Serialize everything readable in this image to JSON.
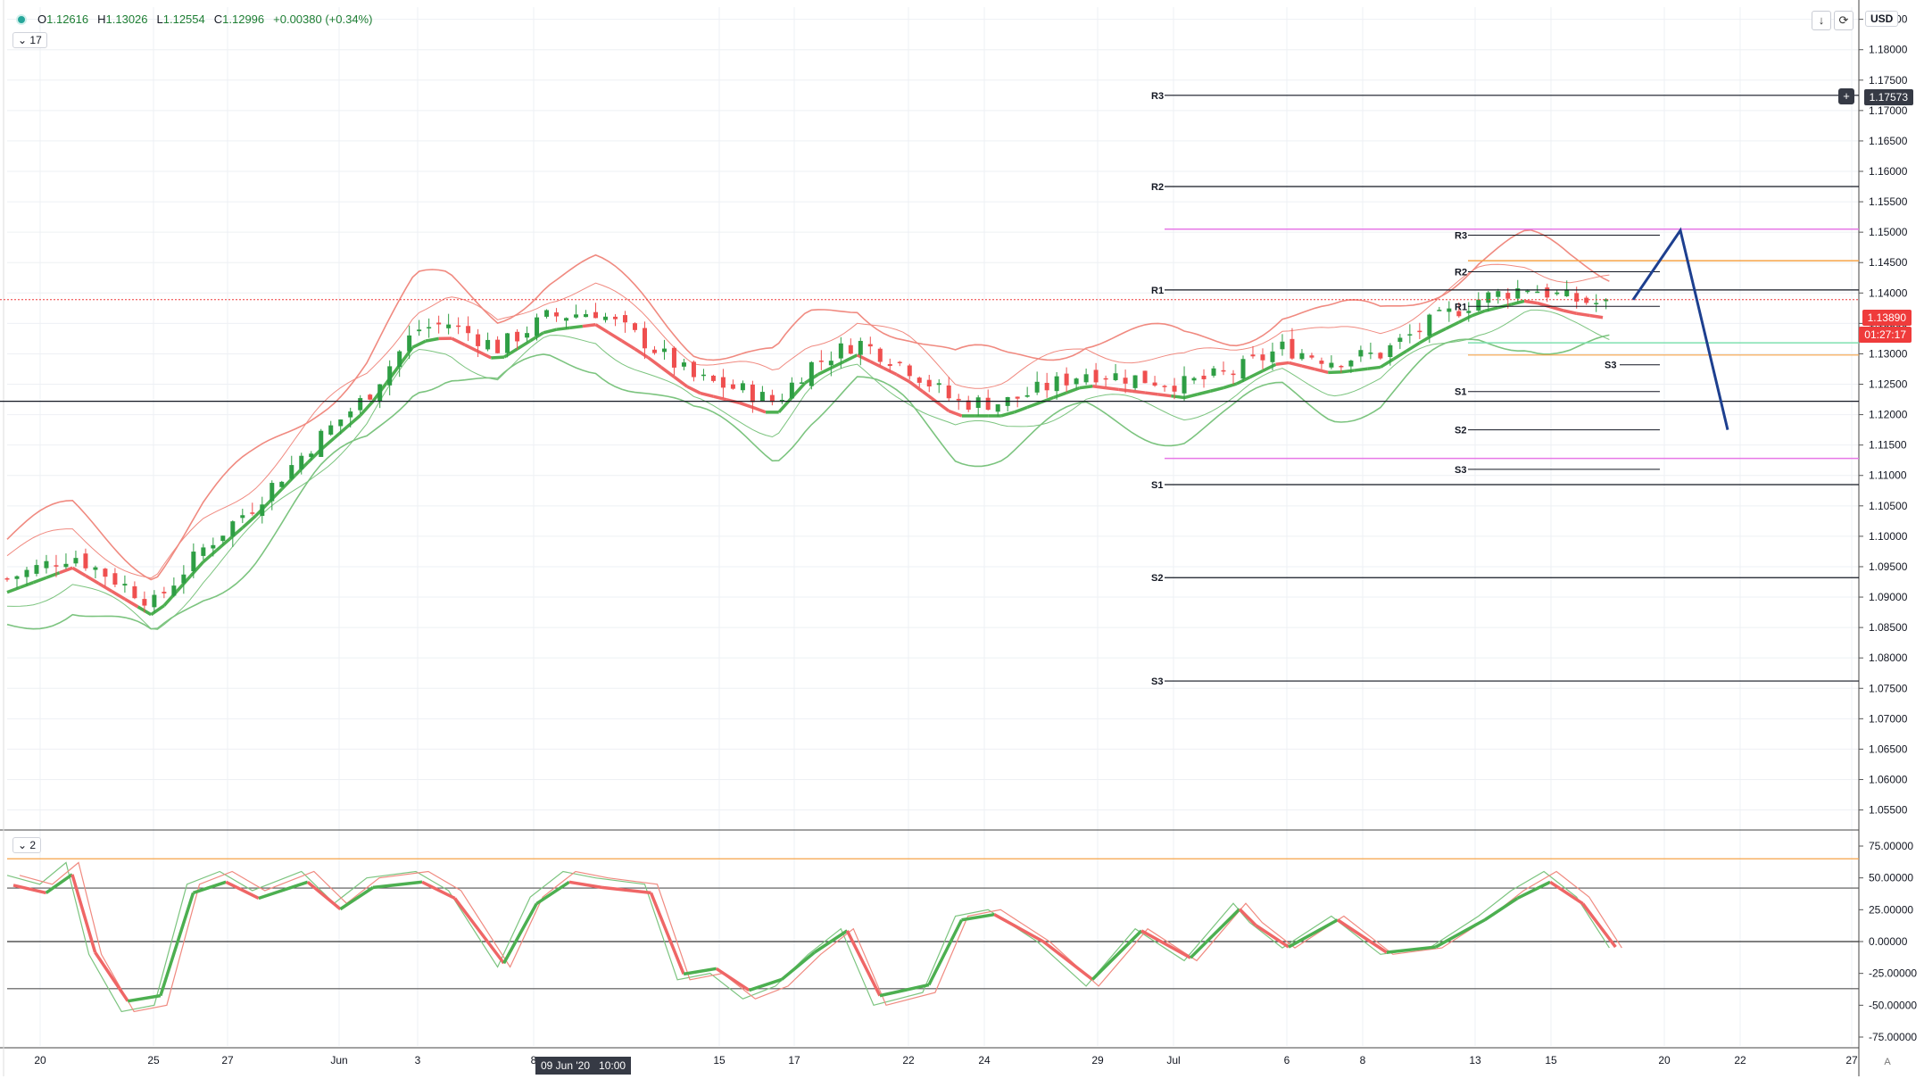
{
  "symbol_bar": {
    "open_label": "O",
    "open": "1.12616",
    "high_label": "H",
    "high": "1.13026",
    "low_label": "L",
    "low": "1.12554",
    "close_label": "C",
    "close": "1.12996",
    "change": "+0.00380 (+0.34%)"
  },
  "main_pane": {
    "indicator_chip": "17",
    "currency": "USD",
    "crosshair_price": "1.17573",
    "last_price": "1.13890",
    "countdown": "01:27:17",
    "y_ticks": [
      "1.18500",
      "1.18000",
      "1.17500",
      "1.17000",
      "1.16500",
      "1.16000",
      "1.15500",
      "1.15000",
      "1.14500",
      "1.14000",
      "1.13500",
      "1.13000",
      "1.12500",
      "1.12000",
      "1.11500",
      "1.11000",
      "1.10500",
      "1.10000",
      "1.09500",
      "1.09000",
      "1.08500",
      "1.08000",
      "1.07500",
      "1.07000",
      "1.06500",
      "1.06000",
      "1.05500"
    ],
    "pivots_big": [
      {
        "label": "R3",
        "price": 1.1725
      },
      {
        "label": "R2",
        "price": 1.1575
      },
      {
        "label": "R1",
        "price": 1.1405
      },
      {
        "label": "S1",
        "price": 1.1085
      },
      {
        "label": "S2",
        "price": 1.0932
      },
      {
        "label": "S3",
        "price": 1.0762
      }
    ],
    "pivots_small": [
      {
        "label": "R3",
        "price": 1.1495
      },
      {
        "label": "R2",
        "price": 1.1435
      },
      {
        "label": "R1",
        "price": 1.1378
      },
      {
        "label": "S1",
        "price": 1.1238
      },
      {
        "label": "S2",
        "price": 1.1175
      },
      {
        "label": "S3",
        "price": 1.111
      }
    ],
    "pivot_extra": [
      {
        "label": "S3",
        "price": 1.1282
      }
    ],
    "colors": {
      "up": "#2e9e44",
      "down": "#ef4f4f",
      "upper_band": "#f08a80",
      "lower_band": "#7cc47f",
      "basis_up": "#4caf50",
      "basis_down": "#ef6666",
      "projection": "#1d3f8f",
      "magenta": "#e678e6",
      "orange": "#f6a347",
      "green_line": "#7fe0b0",
      "pivot": "#131722"
    }
  },
  "osc_pane": {
    "indicator_chip": "2",
    "y_ticks": [
      "75.00000",
      "50.00000",
      "25.00000",
      "0.00000",
      "-25.00000",
      "-50.00000",
      "-75.00000"
    ],
    "levels": [
      {
        "value": 65,
        "color": "#f6a347"
      },
      {
        "value": 42,
        "color": "#555"
      },
      {
        "value": 0,
        "color": "#333"
      },
      {
        "value": -37,
        "color": "#555"
      }
    ]
  },
  "time_axis": {
    "labels": [
      "20",
      "25",
      "27",
      "Jun",
      "3",
      "8",
      "15",
      "17",
      "22",
      "24",
      "29",
      "Jul",
      "6",
      "8",
      "13",
      "15",
      "20",
      "22",
      "27"
    ],
    "cursor_label": "09 Jun '20",
    "cursor_time": "10:00"
  },
  "chart_data": {
    "type": "candlestick",
    "title": "",
    "ylim": [
      1.052,
      1.187
    ],
    "close_trace": [
      [
        0,
        1.093
      ],
      [
        20,
        1.097
      ],
      [
        45,
        1.089
      ],
      [
        60,
        1.098
      ],
      [
        75,
        1.105
      ],
      [
        95,
        1.116
      ],
      [
        110,
        1.123
      ],
      [
        125,
        1.134
      ],
      [
        135,
        1.135
      ],
      [
        150,
        1.131
      ],
      [
        165,
        1.136
      ],
      [
        180,
        1.137
      ],
      [
        195,
        1.132
      ],
      [
        210,
        1.126
      ],
      [
        225,
        1.124
      ],
      [
        235,
        1.122
      ],
      [
        245,
        1.128
      ],
      [
        260,
        1.132
      ],
      [
        275,
        1.128
      ],
      [
        290,
        1.122
      ],
      [
        305,
        1.122
      ],
      [
        315,
        1.124
      ],
      [
        330,
        1.127
      ],
      [
        345,
        1.126
      ],
      [
        360,
        1.125
      ],
      [
        375,
        1.127
      ],
      [
        390,
        1.131
      ],
      [
        405,
        1.129
      ],
      [
        420,
        1.13
      ],
      [
        435,
        1.135
      ],
      [
        450,
        1.139
      ],
      [
        465,
        1.141
      ],
      [
        478,
        1.139
      ],
      [
        490,
        1.138
      ]
    ],
    "projection": [
      [
        490,
        1.1389
      ],
      [
        500,
        1.1503
      ],
      [
        510,
        1.1175
      ]
    ],
    "oscillator": {
      "fast": [
        [
          0,
          52
        ],
        [
          10,
          45
        ],
        [
          18,
          62
        ],
        [
          25,
          -10
        ],
        [
          35,
          -55
        ],
        [
          45,
          -50
        ],
        [
          55,
          45
        ],
        [
          65,
          55
        ],
        [
          75,
          40
        ],
        [
          90,
          55
        ],
        [
          100,
          30
        ],
        [
          110,
          50
        ],
        [
          125,
          55
        ],
        [
          135,
          40
        ],
        [
          150,
          -20
        ],
        [
          160,
          35
        ],
        [
          170,
          55
        ],
        [
          180,
          50
        ],
        [
          195,
          45
        ],
        [
          205,
          -30
        ],
        [
          215,
          -25
        ],
        [
          225,
          -45
        ],
        [
          235,
          -35
        ],
        [
          245,
          -10
        ],
        [
          255,
          10
        ],
        [
          265,
          -50
        ],
        [
          280,
          -40
        ],
        [
          290,
          20
        ],
        [
          300,
          25
        ],
        [
          315,
          0
        ],
        [
          330,
          -35
        ],
        [
          345,
          10
        ],
        [
          360,
          -15
        ],
        [
          375,
          30
        ],
        [
          380,
          15
        ],
        [
          390,
          -5
        ],
        [
          405,
          20
        ],
        [
          420,
          -10
        ],
        [
          435,
          -5
        ],
        [
          450,
          20
        ],
        [
          460,
          40
        ],
        [
          470,
          55
        ],
        [
          480,
          35
        ],
        [
          490,
          -5
        ]
      ]
    }
  }
}
